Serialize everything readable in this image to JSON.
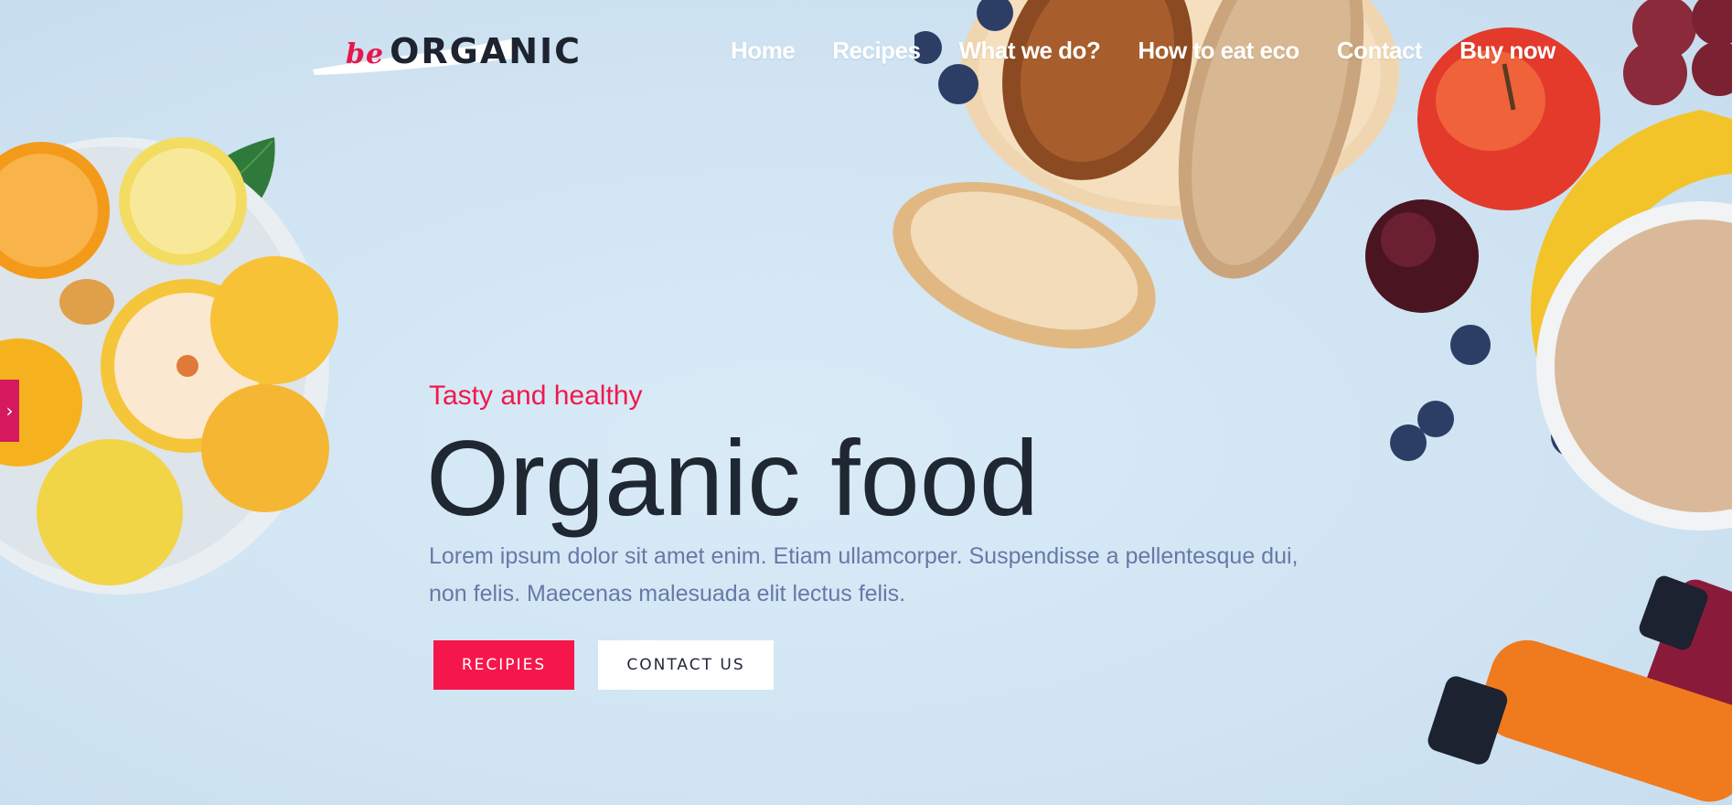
{
  "logo": {
    "prefix": "be",
    "name": "ORGANIC"
  },
  "nav": {
    "items": [
      {
        "label": "Home"
      },
      {
        "label": "Recipes"
      },
      {
        "label": "What we do?"
      },
      {
        "label": "How to eat eco"
      },
      {
        "label": "Contact"
      },
      {
        "label": "Buy now"
      }
    ]
  },
  "hero": {
    "eyebrow": "Tasty and healthy",
    "title": "Organic food",
    "description": "Lorem ipsum dolor sit amet enim. Etiam ullamcorper. Suspendisse a pellentesque dui, non felis. Maecenas malesuada elit lectus felis.",
    "primary_button": "RECIPIES",
    "secondary_button": "CONTACT US"
  },
  "slider": {
    "next_icon": "chevron-right-icon"
  },
  "colors": {
    "accent": "#f5164b",
    "background": "#cfe3f2",
    "heading": "#1f2733",
    "body_text": "#6779a6"
  }
}
